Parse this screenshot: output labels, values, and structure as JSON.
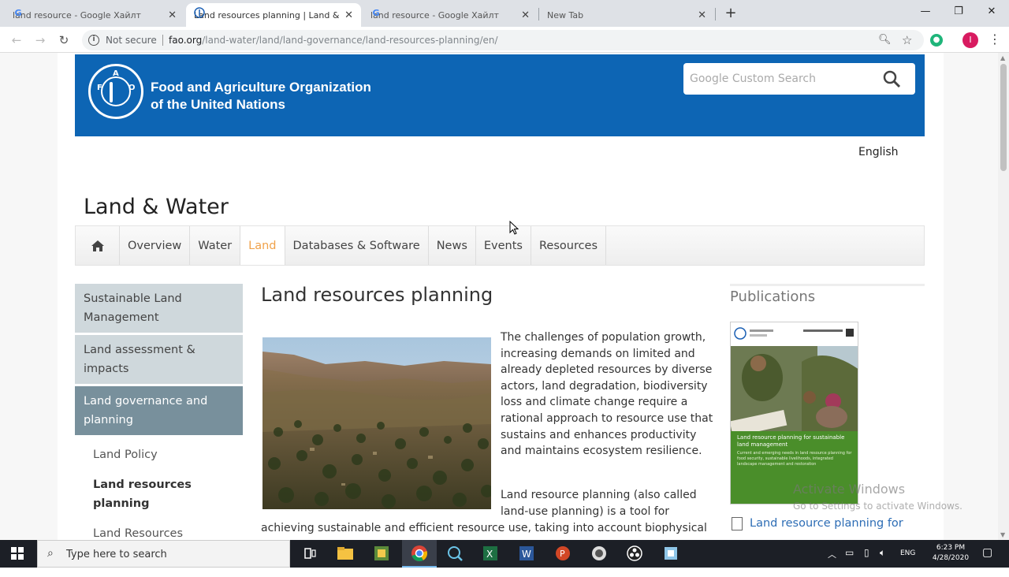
{
  "browser": {
    "tabs": [
      {
        "title": "land resource - Google Хайлт",
        "icon": "G",
        "active": false
      },
      {
        "title": "Land resources planning | Land &",
        "icon": "fao",
        "active": true
      },
      {
        "title": "land resource - Google Хайлт",
        "icon": "G",
        "active": false
      },
      {
        "title": "New Tab",
        "icon": "",
        "active": false
      }
    ],
    "new_tab": "+",
    "not_secure": "Not secure",
    "url_host": "fao.org",
    "url_path": "/land-water/land/land-governance/land-resources-planning/en/",
    "profile_initial": "I"
  },
  "banner": {
    "org_line1": "Food and Agriculture Organization",
    "org_line2": "of the United Nations",
    "logo_letters": [
      "F",
      "A",
      "O"
    ],
    "search_placeholder": "Google Custom Search",
    "color": "#0d65b4"
  },
  "language": "English",
  "section_title": "Land & Water",
  "mainnav": {
    "items": [
      "Overview",
      "Water",
      "Land",
      "Databases & Software",
      "News",
      "Events",
      "Resources"
    ],
    "active": "Land",
    "active_color": "#f0a24a"
  },
  "sidebar": {
    "blocks": [
      {
        "label": "Sustainable Land Management",
        "state": "grey"
      },
      {
        "label": "Land assessment & impacts",
        "state": "grey"
      },
      {
        "label": "Land governance and planning",
        "state": "active"
      }
    ],
    "subitems": [
      {
        "label": "Land Policy",
        "bold": false
      },
      {
        "label": "Land resources planning",
        "bold": true
      },
      {
        "label": "Land Resources Planning",
        "bold": false
      }
    ]
  },
  "article": {
    "title": "Land resources planning",
    "paragraph1": "The challenges of population growth, increasing demands on limited and already depleted resources by diverse actors, land degradation, biodiversity loss and climate change require a rational approach to resource use that sustains and enhances productivity and maintains ecosystem resilience.",
    "paragraph2_part1": "Land resource planning (also called land-use planning) is a tool for",
    "paragraph2_part2": "achieving sustainable and efficient resource use, taking into account biophysical"
  },
  "publications": {
    "heading": "Publications",
    "cover_title": "Land resource planning for sustainable land management",
    "cover_subtitle": "Current and emerging needs in land resource planning for food security, sustainable livelihoods, integrated landscape management and restoration",
    "link": "Land resource planning for"
  },
  "watermark": {
    "line1": "Activate Windows",
    "line2": "Go to Settings to activate Windows."
  },
  "taskbar": {
    "search_placeholder": "Type here to search",
    "time": "6:23 PM",
    "date": "4/28/2020",
    "lang": "ENG"
  }
}
